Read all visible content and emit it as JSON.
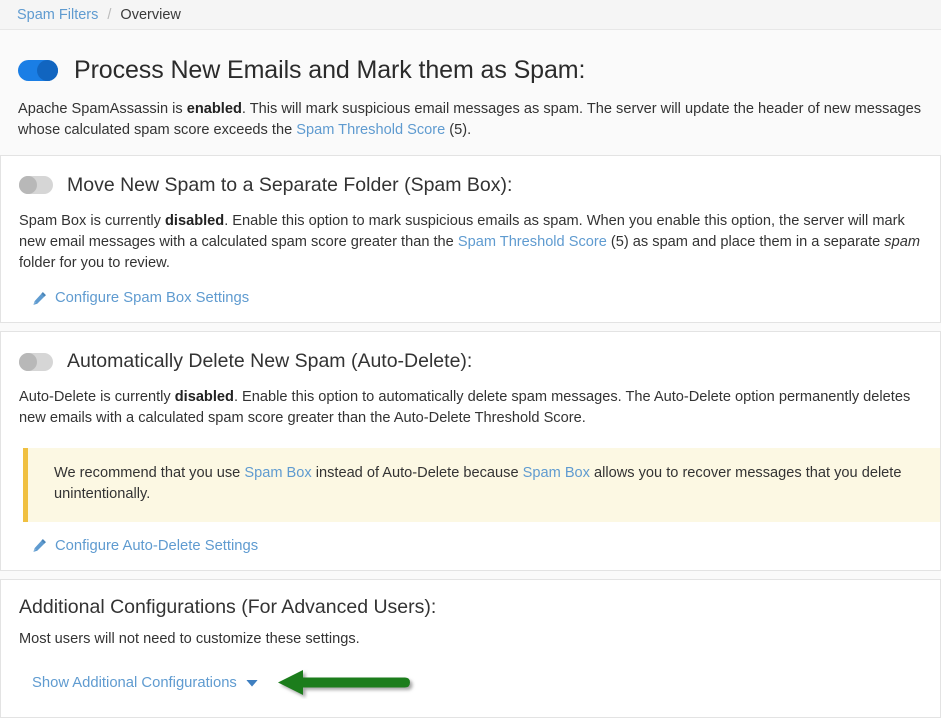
{
  "breadcrumb": {
    "parent": "Spam Filters",
    "separator": "/",
    "current": "Overview"
  },
  "master": {
    "toggle_state": "on",
    "toggle_name": "process-new-emails-toggle",
    "title": "Process New Emails and Mark them as Spam:",
    "desc_part1": "Apache SpamAssassin is ",
    "desc_status": "enabled",
    "desc_part2": ". This will mark suspicious email messages as spam. The server will update the header of new messages whose calculated spam score exceeds the ",
    "desc_link": "Spam Threshold Score",
    "desc_part3": " (5)."
  },
  "spam_box": {
    "toggle_state": "off",
    "title": "Move New Spam to a Separate Folder (Spam Box):",
    "desc_part1": "Spam Box is currently ",
    "desc_status": "disabled",
    "desc_part2": ". Enable this option to mark suspicious emails as spam. When you enable this option, the server will mark new email messages with a calculated spam score greater than the ",
    "desc_link": "Spam Threshold Score",
    "desc_part3": " (5) as spam and place them in a separate ",
    "desc_italic": "spam",
    "desc_part4": " folder for you to review.",
    "configure_link": "Configure Spam Box Settings",
    "configure_icon": "pencil-icon"
  },
  "auto_delete": {
    "toggle_state": "off",
    "title": "Automatically Delete New Spam (Auto-Delete):",
    "desc_part1": "Auto-Delete is currently ",
    "desc_status": "disabled",
    "desc_part2": ". Enable this option to automatically delete spam messages. The Auto-Delete option permanently deletes new emails with a calculated spam score greater than the Auto-Delete Threshold Score.",
    "callout": {
      "part1": "We recommend that you use ",
      "link1": "Spam Box",
      "part2": " instead of Auto-Delete because ",
      "link2": "Spam Box",
      "part3": " allows you to recover messages that you delete unintentionally."
    },
    "configure_link": "Configure Auto-Delete Settings",
    "configure_icon": "pencil-icon"
  },
  "additional": {
    "title": "Additional Configurations (For Advanced Users):",
    "desc": "Most users will not need to customize these settings.",
    "show_link": "Show Additional Configurations",
    "chevron_icon": "chevron-down-icon"
  },
  "annotation": {
    "type": "arrow-left",
    "color": "#1a7d1a",
    "points_to": "Show Additional Configurations"
  },
  "colors": {
    "link": "#5f9bd0",
    "toggle_on_track": "#1a7ee5",
    "toggle_on_knob": "#1165c0",
    "toggle_off_track": "#d6d6d6",
    "callout_bg": "#fcf8e3",
    "callout_border": "#f0c041",
    "annotation_green": "#1a7d1a"
  }
}
